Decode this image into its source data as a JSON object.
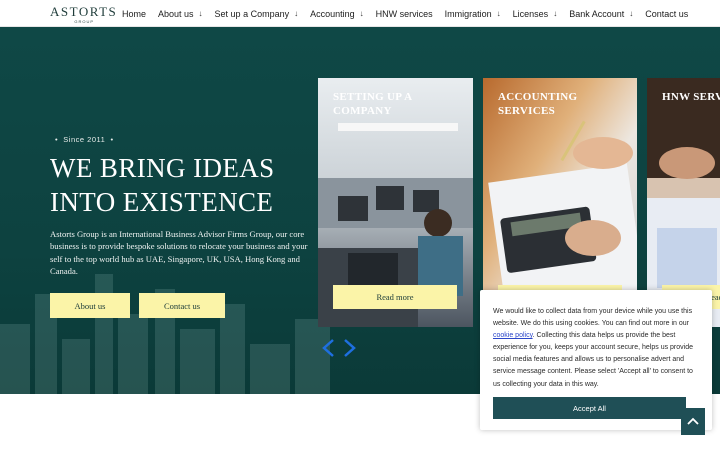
{
  "brand": {
    "name": "ASTORTS",
    "sub": "GROUP"
  },
  "nav": {
    "items": [
      {
        "label": "Home",
        "has_dropdown": false
      },
      {
        "label": "About us",
        "has_dropdown": true
      },
      {
        "label": "Set up a Company",
        "has_dropdown": true
      },
      {
        "label": "Accounting",
        "has_dropdown": true
      },
      {
        "label": "HNW services",
        "has_dropdown": false
      },
      {
        "label": "Immigration",
        "has_dropdown": true
      },
      {
        "label": "Licenses",
        "has_dropdown": true
      },
      {
        "label": "Bank Account",
        "has_dropdown": true
      },
      {
        "label": "Contact us",
        "has_dropdown": false
      }
    ],
    "dropdown_icon": "↓"
  },
  "hero": {
    "since": "Since 2011",
    "headline_line1": "WE BRING IDEAS",
    "headline_line2": "INTO EXISTENCE",
    "description": "Astorts Group is an International Business Advisor Firms Group, our core business is to provide bespoke solutions to relocate your business and your self to the top world hub as UAE, Singapore, UK, USA, Hong Kong and Canada.",
    "btn_about": "About us",
    "btn_contact": "Contact us"
  },
  "cards": [
    {
      "title": "SETTING UP A COMPANY",
      "button": "Read more"
    },
    {
      "title": "ACCOUNTING SERVICES",
      "button": "Read more"
    },
    {
      "title": "HNW SERVICES",
      "button": "Read more"
    }
  ],
  "cookie": {
    "text_before": "We would like to collect data from your device while you use this website. We do this using cookies. You can find out more in our ",
    "link": "cookie policy",
    "text_after": ". Collecting this data helps us provide the best experience for you, keeps your account secure, helps us provide social media features and allows us to personalise advert and service message content. Please select 'Accept all' to consent to us collecting your data in this way.",
    "accept": "Accept All"
  },
  "colors": {
    "hero_bg": "#0e4442",
    "accent_yellow": "#fbf4a8",
    "cookie_button": "#1f4f56",
    "arrow_blue": "#1e6fe0"
  }
}
